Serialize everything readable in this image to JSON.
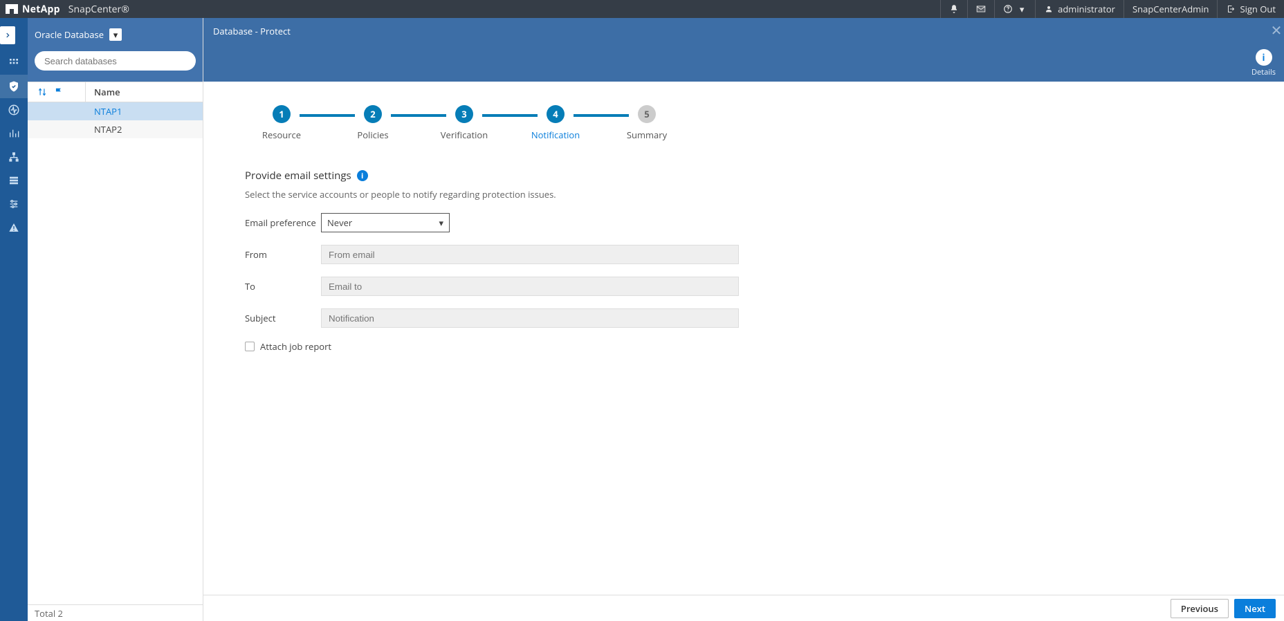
{
  "topbar": {
    "brand": "NetApp",
    "product": "SnapCenter®",
    "user_label": "administrator",
    "scope_label": "SnapCenterAdmin",
    "signout_label": "Sign Out"
  },
  "left_rail": {
    "icons": [
      "apps",
      "shield",
      "activity",
      "chart",
      "hosts",
      "storage",
      "settings",
      "alerts"
    ],
    "active_index": 1
  },
  "sidebar": {
    "scope": "Oracle Database",
    "search_placeholder": "Search databases",
    "name_header": "Name",
    "items": [
      {
        "name": "NTAP1",
        "selected": true
      },
      {
        "name": "NTAP2",
        "selected": false
      }
    ],
    "total_label": "Total 2"
  },
  "main": {
    "title": "Database - Protect",
    "details_label": "Details"
  },
  "wizard": {
    "steps": [
      {
        "num": "1",
        "label": "Resource",
        "state": "done"
      },
      {
        "num": "2",
        "label": "Policies",
        "state": "done"
      },
      {
        "num": "3",
        "label": "Verification",
        "state": "done"
      },
      {
        "num": "4",
        "label": "Notification",
        "state": "current"
      },
      {
        "num": "5",
        "label": "Summary",
        "state": "inactive"
      }
    ]
  },
  "form": {
    "title": "Provide email settings",
    "subtitle": "Select the service accounts or people to notify regarding protection issues.",
    "pref_label": "Email preference",
    "pref_value": "Never",
    "from_label": "From",
    "from_placeholder": "From email",
    "to_label": "To",
    "to_placeholder": "Email to",
    "subject_label": "Subject",
    "subject_placeholder": "Notification",
    "attach_label": "Attach job report"
  },
  "footer": {
    "prev": "Previous",
    "next": "Next"
  }
}
